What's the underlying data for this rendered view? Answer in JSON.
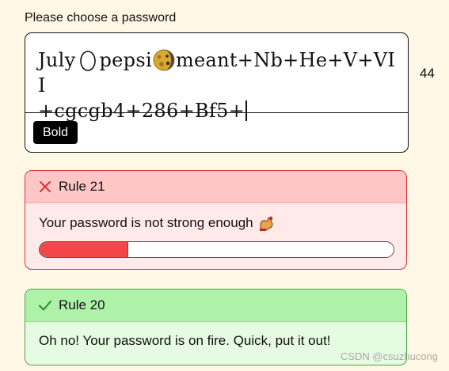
{
  "prompt_label": "Please choose a password",
  "password": {
    "segment_1": "July",
    "emoji_1": "egg-emoji",
    "segment_2": "pepsi",
    "emoji_2": "moon-emoji",
    "segment_3": "meant+Nb+He+V+VII",
    "segment_4": "+cgcgb4+286+Bf5+"
  },
  "toolbar": {
    "bold_label": "Bold"
  },
  "char_count": "44",
  "rules": [
    {
      "title": "Rule 21",
      "status": "error",
      "icon": "cross-icon",
      "message": "Your password is not strong enough",
      "message_icon": "flexed-bicep-icon",
      "strength_fraction": 0.25
    },
    {
      "title": "Rule 20",
      "status": "ok",
      "icon": "check-icon",
      "message": "Oh no! Your password is on fire. Quick, put it out!"
    }
  ],
  "watermark": "CSDN @csuzhucong",
  "colors": {
    "page_bg": "#fff8e6",
    "error_border": "#d9333a",
    "error_header": "#ffc6c6",
    "error_body": "#ffe9e9",
    "ok_border": "#4fa14a",
    "ok_header": "#aef2a9",
    "ok_body": "#e6fce2",
    "progress_fill": "#f2464a"
  }
}
